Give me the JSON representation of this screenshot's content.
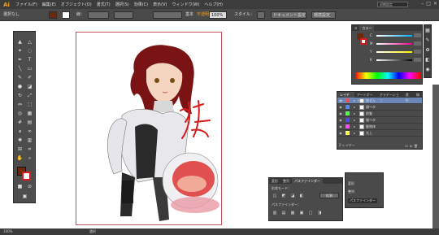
{
  "app": {
    "logo": "Ai"
  },
  "menu": [
    "ファイル(F)",
    "編集(E)",
    "オブジェクト(O)",
    "書式(T)",
    "選択(S)",
    "効果(C)",
    "表示(V)",
    "ウィンドウ(W)",
    "ヘルプ(H)"
  ],
  "workspace": "初期設定",
  "control": {
    "selection": "選択なし",
    "stroke_label": "線：",
    "weight_label": "基本",
    "opacity_label": "不透明度：",
    "opacity_value": "100%",
    "style_label": "スタイル：",
    "doc_setup": "ドキュメント設定",
    "prefs": "環境設定"
  },
  "color_panel": {
    "tabs": [
      "カラー"
    ],
    "labels": [
      "C",
      "M",
      "Y",
      "K"
    ]
  },
  "layers_panel": {
    "tabs": [
      "レイヤー",
      "アートボード",
      "グラデーション",
      "透明",
      "線"
    ],
    "layers": [
      {
        "name": "線せん",
        "color": "#ff4c4c",
        "selected": true
      },
      {
        "name": "顔ベタ",
        "color": "#4c8cff",
        "selected": false
      },
      {
        "name": "前髪",
        "color": "#4cff4c",
        "selected": false
      },
      {
        "name": "服ベタ",
        "color": "#4c4cff",
        "selected": false
      },
      {
        "name": "髪物体",
        "color": "#ff4cff",
        "selected": false
      },
      {
        "name": "光上",
        "color": "#ffff4c",
        "selected": false
      }
    ],
    "footer": "2 レイヤー"
  },
  "pathfinder": {
    "tabs": [
      "変形",
      "整列",
      "パスファインダー"
    ],
    "shape_modes": "形状モード：",
    "expand": "拡張",
    "pathfinders": "パスファインダー："
  },
  "mini_panel": {
    "items": [
      "変形",
      "整列",
      "パスファインダー"
    ]
  },
  "status": {
    "zoom": "100%",
    "mode": "選択"
  },
  "colors": {
    "ui_dark": "#3c3c3c",
    "accent": "#f7a11a",
    "selection_blue": "#6a87b8",
    "artboard_border": "#c64e5c"
  }
}
